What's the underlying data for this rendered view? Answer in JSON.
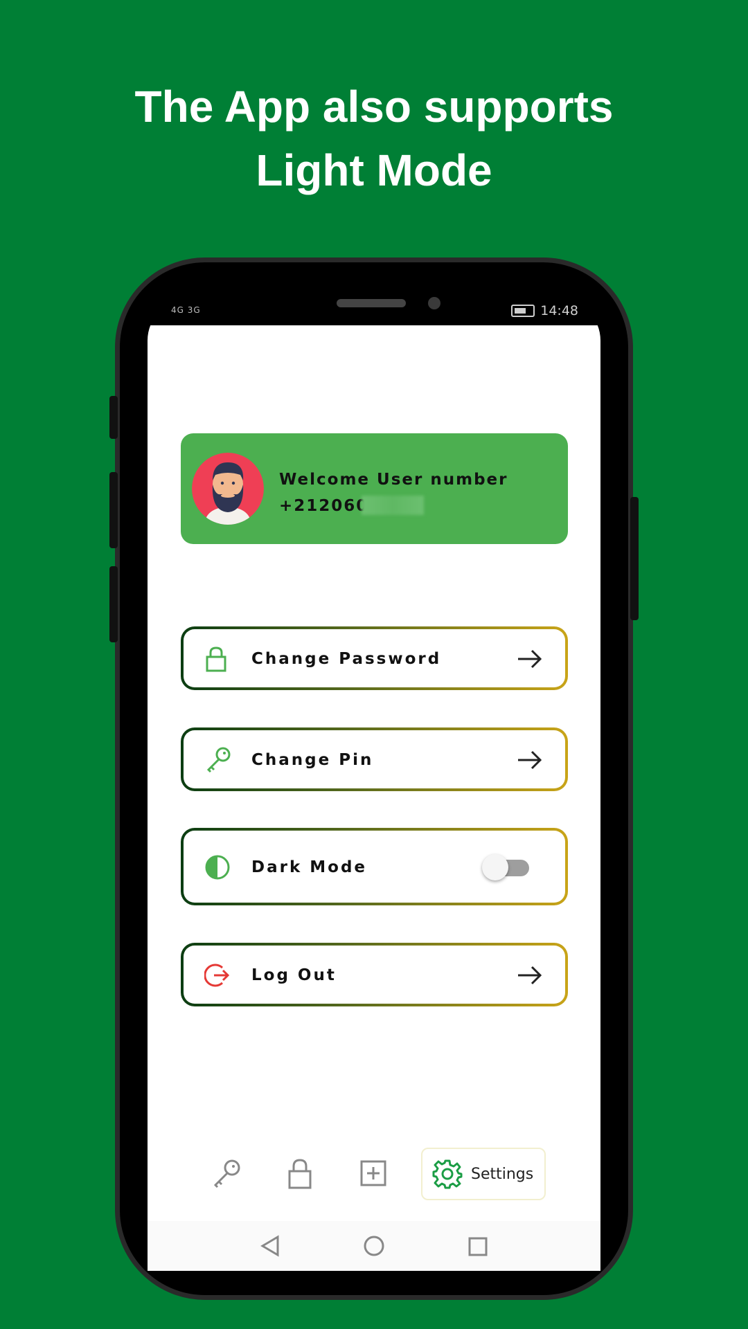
{
  "headline": {
    "line1": "The App also supports",
    "line2": "Light Mode"
  },
  "status_bar": {
    "left_text": "4G 3G",
    "time": "14:48"
  },
  "welcome": {
    "title": "Welcome User number",
    "phone": "+2120600"
  },
  "menu": {
    "change_password": "Change Password",
    "change_pin": "Change Pin",
    "dark_mode": "Dark Mode",
    "dark_mode_enabled": false,
    "log_out": "Log Out"
  },
  "bottom_nav": {
    "settings_label": "Settings",
    "active_tab": "Settings"
  },
  "colors": {
    "background": "#007f35",
    "card": "#4caf50",
    "accent_green": "#4caf50",
    "logout_red": "#e53935",
    "border_gradient_start": "#0b3d12",
    "border_gradient_end": "#c9a418"
  },
  "icons": {
    "change_password": "lock-icon",
    "change_pin": "key-icon",
    "dark_mode": "contrast-icon",
    "log_out": "logout-icon",
    "arrow": "arrow-right-icon",
    "nav": [
      "key-icon",
      "lock-icon",
      "add-square-icon",
      "gear-icon"
    ],
    "android": [
      "back-icon",
      "home-icon",
      "recents-icon"
    ]
  }
}
